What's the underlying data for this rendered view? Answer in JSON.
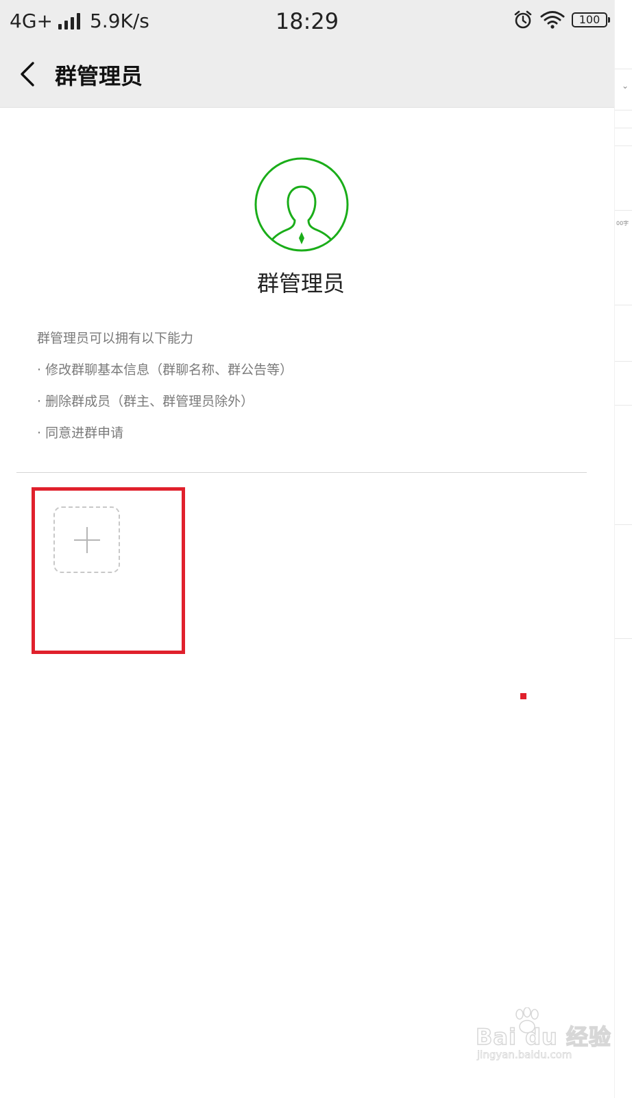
{
  "status_bar": {
    "network": "4G+",
    "speed": "5.9K/s",
    "time": "18:29",
    "battery": "100"
  },
  "nav": {
    "title": "群管理员"
  },
  "hero": {
    "title": "群管理员"
  },
  "description": {
    "intro": "群管理员可以拥有以下能力",
    "items": [
      "· 修改群聊基本信息（群聊名称、群公告等）",
      "· 删除群成员（群主、群管理员除外）",
      "· 同意进群申请"
    ]
  },
  "side_strip": {
    "text": "00字"
  },
  "watermark": {
    "brand": "Bai du 经验",
    "url": "jingyan.baidu.com"
  },
  "colors": {
    "accent_green": "#1aad19",
    "highlight_red": "#e0202c",
    "bar_gray": "#ededed"
  }
}
